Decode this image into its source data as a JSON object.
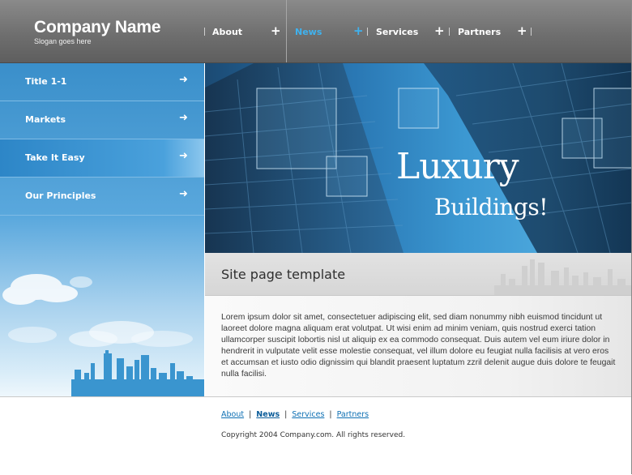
{
  "header": {
    "company_name": "Company Name",
    "slogan": "Slogan goes here",
    "nav": [
      {
        "label": "About",
        "active": false
      },
      {
        "label": "News",
        "active": true
      },
      {
        "label": "Services",
        "active": false
      },
      {
        "label": "Partners",
        "active": false
      }
    ],
    "plus_symbol": "+"
  },
  "sidebar": {
    "items": [
      {
        "label": "Title 1-1"
      },
      {
        "label": "Markets"
      },
      {
        "label": "Take It Easy"
      },
      {
        "label": "Our Principles"
      }
    ],
    "active_item": "Take It Easy",
    "arrow_icon": "arrow-right-icon"
  },
  "banner": {
    "title": "Luxury",
    "subtitle": "Buildings!"
  },
  "main": {
    "page_title": "Site page template",
    "body_text": "Lorem ipsum dolor sit amet, consectetuer adipiscing elit, sed diam nonummy nibh euismod tincidunt ut laoreet dolore magna aliquam erat volutpat. Ut wisi enim ad minim veniam, quis nostrud exerci tation ullamcorper suscipit lobortis nisl ut aliquip ex ea commodo consequat. Duis autem vel eum iriure dolor in hendrerit in vulputate velit esse molestie consequat, vel illum dolore eu feugiat nulla facilisis at vero eros et accumsan et iusto odio dignissim qui blandit praesent luptatum zzril delenit augue duis dolore te feugait nulla facilisi."
  },
  "footer": {
    "links": [
      {
        "label": "About"
      },
      {
        "label": "News"
      },
      {
        "label": "Services"
      },
      {
        "label": "Partners"
      }
    ],
    "separator": "|",
    "copyright": "Copyright 2004 Company.com. All rights reserved."
  },
  "colors": {
    "header_gray": "#6f6f6f",
    "active_nav": "#3fb2ef",
    "sidebar_blue": "#3a8fca",
    "link_blue": "#0d6fb3"
  }
}
